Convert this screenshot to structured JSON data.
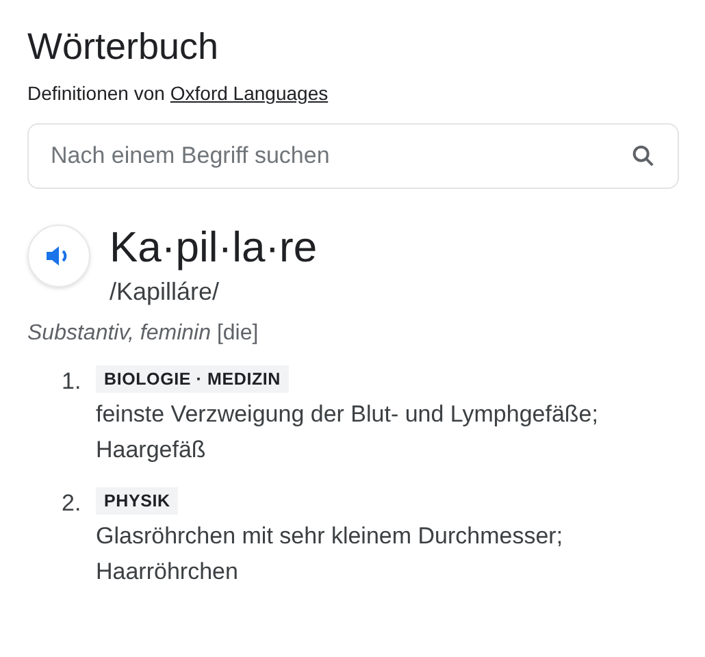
{
  "title": "Wörterbuch",
  "source": {
    "prefix": "Definitionen von",
    "link": "Oxford Languages"
  },
  "search": {
    "placeholder": "Nach einem Begriff suchen"
  },
  "entry": {
    "headword": "Ka·pil·la·re",
    "pronunciation": "/Kapilláre/",
    "grammar": "*Substantiv, feminin* [die]"
  },
  "senses": [
    {
      "number": "1.",
      "tag": "BIOLOGIE · MEDIZIN",
      "definition": "feinste Verzweigung der Blut- und Lymphgefäße; Haargefäß"
    },
    {
      "number": "2.",
      "tag": "PHYSIK",
      "definition": "Glasröhrchen mit sehr kleinem Durchmesser; Haarröhrchen"
    }
  ]
}
